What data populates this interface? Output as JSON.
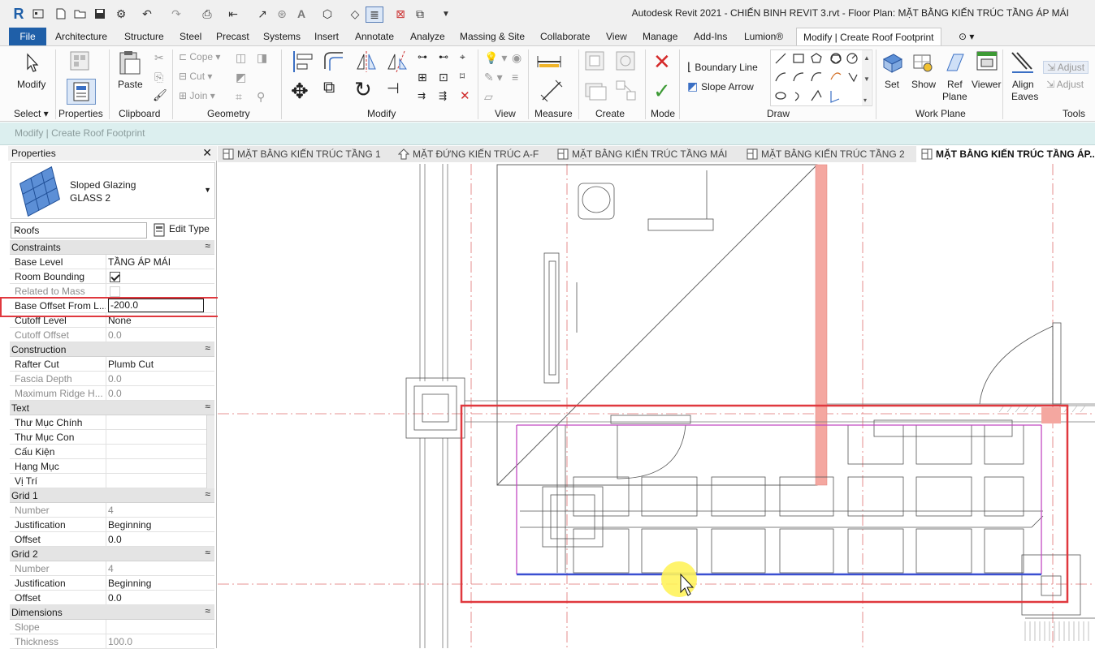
{
  "window": {
    "title": "Autodesk Revit 2021 - CHIẾN BINH REVIT 3.rvt - Floor Plan: MẶT BẰNG KIẾN TRÚC TẦNG ÁP MÁI"
  },
  "menu": {
    "file": "File",
    "tabs": [
      "Architecture",
      "Structure",
      "Steel",
      "Precast",
      "Systems",
      "Insert",
      "Annotate",
      "Analyze",
      "Massing & Site",
      "Collaborate",
      "View",
      "Manage",
      "Add-Ins",
      "Lumion®"
    ],
    "active_tab": "Modify | Create Roof Footprint"
  },
  "ribbon": {
    "select": {
      "modify": "Modify",
      "panel": "Select ▾"
    },
    "properties": {
      "label": "Properties",
      "panel": "Properties"
    },
    "clipboard": {
      "paste": "Paste",
      "panel": "Clipboard"
    },
    "geometry": {
      "cope": "Cope",
      "cut": "Cut",
      "join": "Join",
      "panel": "Geometry"
    },
    "modify_panel": "Modify",
    "view_panel": "View",
    "measure_panel": "Measure",
    "create_panel": "Create",
    "mode_panel": "Mode",
    "draw": {
      "boundary_line": "Boundary Line",
      "slope_arrow": "Slope Arrow",
      "panel": "Draw"
    },
    "work_plane": {
      "set": "Set",
      "show": "Show",
      "ref": "Ref",
      "plane": "Plane",
      "viewer": "Viewer",
      "panel": "Work Plane"
    },
    "tools": {
      "align": "Align",
      "eaves": "Eaves",
      "adjust1": "Adjust",
      "adjust2": "Adjust",
      "panel": "Tools"
    }
  },
  "context_bar": "Modify | Create Roof Footprint",
  "properties": {
    "title": "Properties",
    "type_family": "Sloped Glazing",
    "type_name": "GLASS 2",
    "category": "Roofs",
    "edit_type": "Edit Type",
    "groups": [
      {
        "name": "Constraints",
        "rows": [
          {
            "key": "Base Level",
            "value": "TẦNG ÁP MÁI"
          },
          {
            "key": "Room Bounding",
            "checkbox": true
          },
          {
            "key": "Related to Mass",
            "checkbox": false,
            "dim": true
          },
          {
            "key": "Base Offset From L...",
            "value": "-200.0",
            "editing": true
          },
          {
            "key": "Cutoff Level",
            "value": "None"
          },
          {
            "key": "Cutoff Offset",
            "value": "0.0",
            "dim": true
          }
        ]
      },
      {
        "name": "Construction",
        "rows": [
          {
            "key": "Rafter Cut",
            "value": "Plumb Cut"
          },
          {
            "key": "Fascia Depth",
            "value": "0.0",
            "dim": true
          },
          {
            "key": "Maximum Ridge H...",
            "value": "0.0",
            "dim": true
          }
        ]
      },
      {
        "name": "Text",
        "rows": [
          {
            "key": "Thư Mục Chính",
            "value": "",
            "scroll": true
          },
          {
            "key": "Thư Mục Con",
            "value": "",
            "scroll": true
          },
          {
            "key": "Cấu Kiện",
            "value": "",
            "scroll": true
          },
          {
            "key": "Hạng Mục",
            "value": "",
            "scroll": true
          },
          {
            "key": "Vị Trí",
            "value": "",
            "scroll": true
          }
        ]
      },
      {
        "name": "Grid 1",
        "rows": [
          {
            "key": "Number",
            "value": "4",
            "dim": true
          },
          {
            "key": "Justification",
            "value": "Beginning"
          },
          {
            "key": "Offset",
            "value": "0.0"
          }
        ]
      },
      {
        "name": "Grid 2",
        "rows": [
          {
            "key": "Number",
            "value": "4",
            "dim": true
          },
          {
            "key": "Justification",
            "value": "Beginning"
          },
          {
            "key": "Offset",
            "value": "0.0"
          }
        ]
      },
      {
        "name": "Dimensions",
        "rows": [
          {
            "key": "Slope",
            "value": "",
            "dim": true
          },
          {
            "key": "Thickness",
            "value": "100.0",
            "dim": true
          }
        ]
      }
    ]
  },
  "view_tabs": [
    {
      "label": "MẶT BẰNG KIẾN TRÚC TẦNG 1",
      "icon": "floor-plan-icon"
    },
    {
      "label": "MẶT ĐỨNG KIẾN TRÚC A-F",
      "icon": "elevation-icon"
    },
    {
      "label": "MẶT BẰNG KIẾN TRÚC TẦNG MÁI",
      "icon": "floor-plan-icon"
    },
    {
      "label": "MẶT BẰNG KIẾN TRÚC TẦNG 2",
      "icon": "floor-plan-icon"
    },
    {
      "label": "MẶT BẰNG KIẾN TRÚC TẦNG ÁP...",
      "icon": "floor-plan-icon",
      "active": true
    }
  ],
  "colors": {
    "file_tab": "#1f5fa8",
    "highlight_box": "#e0383e",
    "footprint_magenta": "#c24ac2",
    "footprint_blue": "#3a4fd1",
    "wall_pink": "#f4a7a0",
    "context_bar": "#dcefef",
    "cursor_glow": "#fff35c"
  }
}
